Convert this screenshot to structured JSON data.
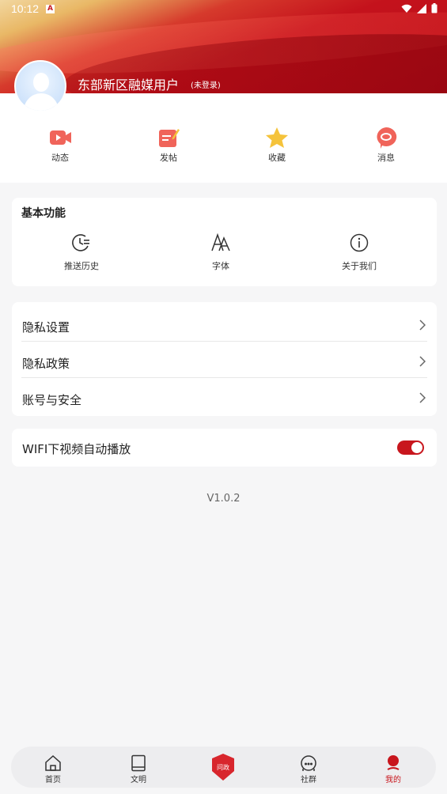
{
  "status_bar": {
    "time": "10:12",
    "notification_glyph": "A"
  },
  "profile": {
    "username": "东部新区融媒用户",
    "login_status": "(未登录)"
  },
  "quick_actions": [
    {
      "label": "动态",
      "icon": "video-icon"
    },
    {
      "label": "发帖",
      "icon": "post-edit-icon"
    },
    {
      "label": "收藏",
      "icon": "star-icon"
    },
    {
      "label": "消息",
      "icon": "message-icon"
    }
  ],
  "basic_functions": {
    "title": "基本功能",
    "items": [
      {
        "label": "推送历史",
        "icon": "history-icon"
      },
      {
        "label": "字体",
        "icon": "font-icon"
      },
      {
        "label": "关于我们",
        "icon": "info-icon"
      }
    ]
  },
  "settings": {
    "items": [
      {
        "label": "隐私设置"
      },
      {
        "label": "隐私政策"
      },
      {
        "label": "账号与安全"
      }
    ]
  },
  "wifi_autoplay": {
    "label": "WIFI下视频自动播放",
    "enabled": true
  },
  "version": "V1.0.2",
  "bottom_nav": {
    "items": [
      {
        "label": "首页",
        "icon": "home-icon"
      },
      {
        "label": "文明",
        "icon": "book-icon"
      },
      {
        "label": "",
        "icon": "wenzheng-badge-icon",
        "badge_text": "问政"
      },
      {
        "label": "社群",
        "icon": "community-icon"
      },
      {
        "label": "我的",
        "icon": "profile-icon",
        "active": true
      }
    ]
  },
  "colors": {
    "accent": "#c8161d",
    "background": "#f6f6f7"
  }
}
